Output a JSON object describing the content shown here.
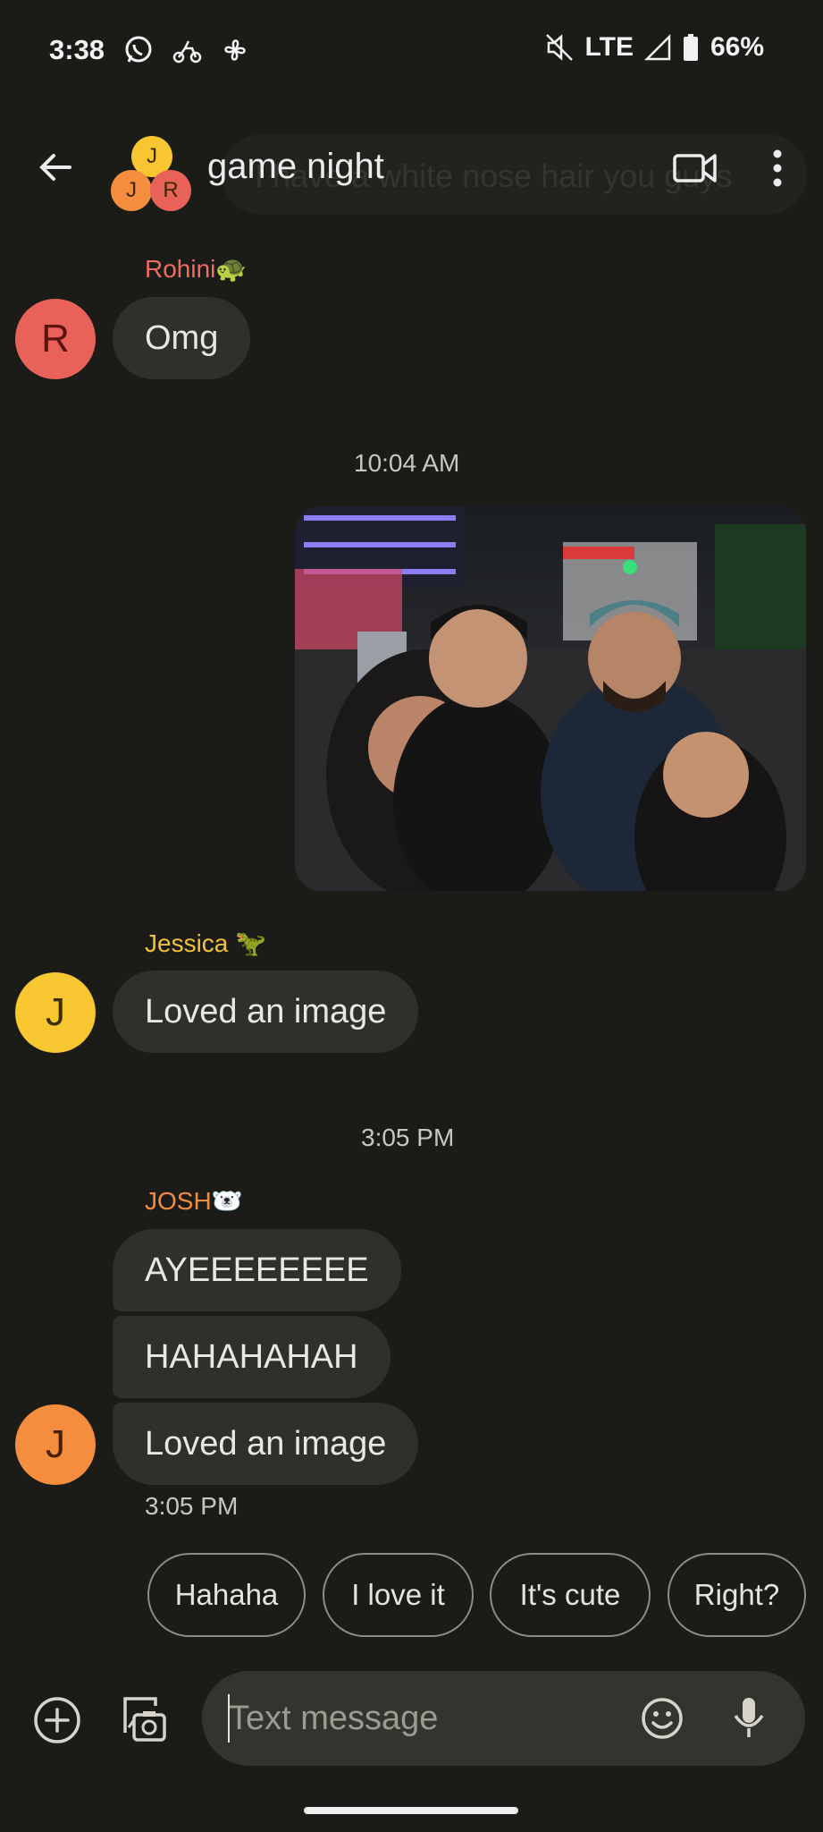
{
  "status_bar": {
    "time": "3:38",
    "network": "LTE",
    "battery": "66%",
    "icons_left": [
      "whatsapp-icon",
      "delivery-bike-icon",
      "pinwheel-icon"
    ],
    "icons_right": [
      "mute-icon",
      "signal-icon",
      "battery-icon"
    ]
  },
  "header": {
    "title": "game night",
    "ghost_text": "I have a white nose hair you guys",
    "group_avatar_letters": [
      "J",
      "J",
      "R"
    ]
  },
  "messages": [
    {
      "sender": "Rohini🐢",
      "sender_color": "#ef6c64",
      "avatar_letter": "R",
      "avatar_color": "#e8625a",
      "texts": [
        "Omg"
      ]
    },
    {
      "time": "10:04 AM"
    },
    {
      "photo": true
    },
    {
      "sender": "Jessica 🦖",
      "sender_color": "#f2c13a",
      "avatar_letter": "J",
      "avatar_color": "#f8c630",
      "texts": [
        "Loved an image"
      ]
    },
    {
      "time": "3:05 PM"
    },
    {
      "sender": "JOSH🐻‍❄️",
      "sender_color": "#f28c3a",
      "avatar_letter": "J",
      "avatar_color": "#f48d3d",
      "texts": [
        "AYEEEEEEEE",
        "HAHAHAHAH",
        "Loved an image"
      ],
      "footer_time": "3:05 PM"
    }
  ],
  "smart_replies": [
    "Hahaha",
    "I love it",
    "It's cute",
    "Right?"
  ],
  "composer": {
    "placeholder": "Text message"
  }
}
